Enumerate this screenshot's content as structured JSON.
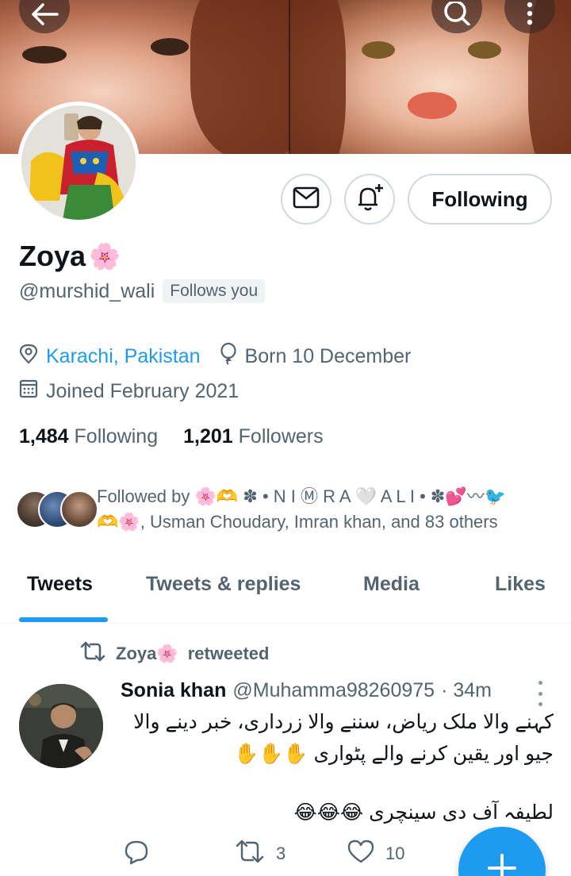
{
  "profile": {
    "name": "Zoya",
    "name_emoji": "🌸",
    "handle": "@murshid_wali",
    "follows_you": "Follows you",
    "location": "Karachi, Pakistan",
    "birthday": "Born 10 December",
    "joined": "Joined February 2021",
    "following_count": "1,484",
    "following_label": "Following",
    "followers_count": "1,201",
    "followers_label": "Followers",
    "follow_button": "Following"
  },
  "followed_by": {
    "line1": "Followed by 🌸🫶 ✽ • N I Ⓜ R A 🤍 A L I • ✽💕〰🐦",
    "line2": "🫶🌸, Usman Choudary, Imran khan, and 83 others"
  },
  "tabs": [
    {
      "label": "Tweets",
      "active": true
    },
    {
      "label": "Tweets & replies",
      "active": false
    },
    {
      "label": "Media",
      "active": false
    },
    {
      "label": "Likes",
      "active": false
    }
  ],
  "tweet": {
    "retweeter": "Zoya🌸",
    "retweet_text": "retweeted",
    "author_name": "Sonia khan",
    "author_handle": "@Muhamma98260975",
    "time": "· 34m",
    "line1": "کہنے والا ملک ریاض، سننے والا زرداری، خبر دینے والا",
    "line2": "جیو اور یقین کرنے والے پٹواری ✋✋✋",
    "line3": "لطیفہ آف دی سینچری 😂😂😂",
    "retweets": "3",
    "likes": "10"
  },
  "colors": {
    "accent": "#1d9bf0",
    "text_primary": "#0f1419",
    "text_secondary": "#536471",
    "border": "#cfd9de"
  },
  "icons": {
    "back": "arrow-left-icon",
    "search": "search-icon",
    "more": "more-vertical-icon",
    "message": "envelope-icon",
    "notify": "bell-plus-icon",
    "location": "location-pin-icon",
    "birthday": "balloon-icon",
    "joined": "calendar-icon",
    "retweet": "retweet-icon",
    "reply": "reply-icon",
    "like": "heart-icon",
    "compose": "plus-icon"
  }
}
